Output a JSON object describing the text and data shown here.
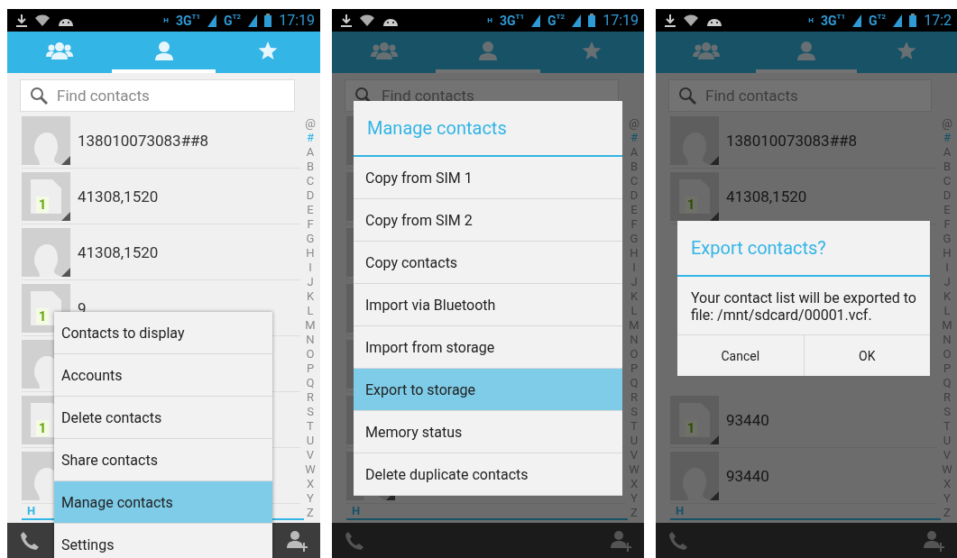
{
  "phones": [
    {
      "status_bar": {
        "data_type": "H",
        "networks": [
          {
            "label": "3G",
            "sim": "T1"
          },
          {
            "label": "G",
            "sim": "T2"
          }
        ],
        "time": "17:19"
      },
      "tabs": [
        {
          "selected": false
        },
        {
          "selected": true
        },
        {
          "selected": false
        }
      ],
      "search": {
        "placeholder": "Find contacts"
      },
      "contacts": [
        {
          "kind": "person",
          "name": "138010073083##8"
        },
        {
          "kind": "sim",
          "badge": "1",
          "name": "41308,1520"
        },
        {
          "kind": "person",
          "name": "41308,1520"
        },
        {
          "kind": "sim",
          "badge": "1",
          "name": "9"
        },
        {
          "kind": "person"
        },
        {
          "kind": "sim",
          "badge": "1"
        },
        {
          "kind": "person"
        }
      ],
      "section_header": "H",
      "index_letters": [
        {
          "label": "@",
          "selected": false
        },
        {
          "label": "#",
          "selected": true
        },
        {
          "label": "A",
          "selected": false
        },
        {
          "label": "B",
          "selected": false
        },
        {
          "label": "C",
          "selected": false
        },
        {
          "label": "D",
          "selected": false
        },
        {
          "label": "E",
          "selected": false
        },
        {
          "label": "F",
          "selected": false
        },
        {
          "label": "G",
          "selected": false
        },
        {
          "label": "H",
          "selected": false
        },
        {
          "label": "I",
          "selected": false
        },
        {
          "label": "J",
          "selected": false
        },
        {
          "label": "K",
          "selected": false
        },
        {
          "label": "L",
          "selected": false
        },
        {
          "label": "M",
          "selected": false
        },
        {
          "label": "N",
          "selected": false
        },
        {
          "label": "O",
          "selected": false
        },
        {
          "label": "P",
          "selected": false
        },
        {
          "label": "Q",
          "selected": false
        },
        {
          "label": "R",
          "selected": false
        },
        {
          "label": "S",
          "selected": false
        },
        {
          "label": "T",
          "selected": false
        },
        {
          "label": "U",
          "selected": false
        },
        {
          "label": "V",
          "selected": false
        },
        {
          "label": "W",
          "selected": false
        },
        {
          "label": "X",
          "selected": false
        },
        {
          "label": "Y",
          "selected": false
        },
        {
          "label": "Z",
          "selected": false
        }
      ],
      "dimmed": false,
      "overlay": {
        "kind": "menu",
        "items": [
          {
            "label": "Contacts to display",
            "selected": false
          },
          {
            "label": "Accounts",
            "selected": false
          },
          {
            "label": "Delete contacts",
            "selected": false
          },
          {
            "label": "Share contacts",
            "selected": false
          },
          {
            "label": "Manage contacts",
            "selected": true
          },
          {
            "label": "Settings",
            "selected": false
          }
        ]
      }
    },
    {
      "status_bar": {
        "data_type": "H",
        "networks": [
          {
            "label": "3G",
            "sim": "T1"
          },
          {
            "label": "G",
            "sim": "T2"
          }
        ],
        "time": "17:19"
      },
      "tabs": [
        {
          "selected": false
        },
        {
          "selected": true
        },
        {
          "selected": false
        }
      ],
      "search": {
        "placeholder": "Find contacts"
      },
      "contacts": [
        {
          "kind": "person"
        },
        {
          "kind": "sim"
        },
        {
          "kind": "person"
        },
        {
          "kind": "sim"
        },
        {
          "kind": "person"
        },
        {
          "kind": "sim"
        },
        {
          "kind": "person"
        }
      ],
      "section_header": "H",
      "index_letters": [
        {
          "label": "@",
          "selected": false
        },
        {
          "label": "#",
          "selected": true
        },
        {
          "label": "A",
          "selected": false
        },
        {
          "label": "B",
          "selected": false
        },
        {
          "label": "C",
          "selected": false
        },
        {
          "label": "D",
          "selected": false
        },
        {
          "label": "E",
          "selected": false
        },
        {
          "label": "F",
          "selected": false
        },
        {
          "label": "G",
          "selected": false
        },
        {
          "label": "H",
          "selected": false
        },
        {
          "label": "I",
          "selected": false
        },
        {
          "label": "J",
          "selected": false
        },
        {
          "label": "K",
          "selected": false
        },
        {
          "label": "L",
          "selected": false
        },
        {
          "label": "M",
          "selected": false
        },
        {
          "label": "N",
          "selected": false
        },
        {
          "label": "O",
          "selected": false
        },
        {
          "label": "P",
          "selected": false
        },
        {
          "label": "Q",
          "selected": false
        },
        {
          "label": "R",
          "selected": false
        },
        {
          "label": "S",
          "selected": false
        },
        {
          "label": "T",
          "selected": false
        },
        {
          "label": "U",
          "selected": false
        },
        {
          "label": "V",
          "selected": false
        },
        {
          "label": "W",
          "selected": false
        },
        {
          "label": "X",
          "selected": false
        },
        {
          "label": "Y",
          "selected": false
        },
        {
          "label": "Z",
          "selected": false
        }
      ],
      "dimmed": true,
      "overlay": {
        "kind": "list_dialog",
        "title": "Manage contacts",
        "items": [
          {
            "label": "Copy from SIM 1",
            "selected": false
          },
          {
            "label": "Copy from SIM 2",
            "selected": false
          },
          {
            "label": "Copy contacts",
            "selected": false
          },
          {
            "label": "Import via Bluetooth",
            "selected": false
          },
          {
            "label": "Import from storage",
            "selected": false
          },
          {
            "label": "Export to storage",
            "selected": true
          },
          {
            "label": "Memory status",
            "selected": false
          },
          {
            "label": "Delete duplicate contacts",
            "selected": false
          }
        ]
      }
    },
    {
      "status_bar": {
        "data_type": "H",
        "networks": [
          {
            "label": "3G",
            "sim": "T1"
          },
          {
            "label": "G",
            "sim": "T2"
          }
        ],
        "time": "17:2"
      },
      "tabs": [
        {
          "selected": false
        },
        {
          "selected": true
        },
        {
          "selected": false
        }
      ],
      "search": {
        "placeholder": "Find contacts"
      },
      "contacts": [
        {
          "kind": "person",
          "name": "138010073083##8"
        },
        {
          "kind": "sim",
          "badge": "1",
          "name": "41308,1520"
        }
      ],
      "contacts_below_dialog": [
        {
          "kind": "sim",
          "badge": "1",
          "name": "93440"
        },
        {
          "kind": "person",
          "name": "93440"
        }
      ],
      "section_header": "H",
      "index_letters": [
        {
          "label": "@",
          "selected": false
        },
        {
          "label": "#",
          "selected": true
        },
        {
          "label": "A",
          "selected": false
        },
        {
          "label": "B",
          "selected": false
        },
        {
          "label": "C",
          "selected": false
        },
        {
          "label": "D",
          "selected": false
        },
        {
          "label": "E",
          "selected": false
        },
        {
          "label": "F",
          "selected": false
        },
        {
          "label": "G",
          "selected": false
        },
        {
          "label": "H",
          "selected": false
        },
        {
          "label": "I",
          "selected": false
        },
        {
          "label": "J",
          "selected": false
        },
        {
          "label": "K",
          "selected": false
        },
        {
          "label": "L",
          "selected": false
        },
        {
          "label": "M",
          "selected": false
        },
        {
          "label": "N",
          "selected": false
        },
        {
          "label": "O",
          "selected": false
        },
        {
          "label": "P",
          "selected": false
        },
        {
          "label": "Q",
          "selected": false
        },
        {
          "label": "R",
          "selected": false
        },
        {
          "label": "S",
          "selected": false
        },
        {
          "label": "T",
          "selected": false
        },
        {
          "label": "U",
          "selected": false
        },
        {
          "label": "V",
          "selected": false
        },
        {
          "label": "W",
          "selected": false
        },
        {
          "label": "X",
          "selected": false
        },
        {
          "label": "Y",
          "selected": false
        },
        {
          "label": "Z",
          "selected": false
        }
      ],
      "dimmed": true,
      "overlay": {
        "kind": "confirm_dialog",
        "title": "Export contacts?",
        "message": "Your contact list will be exported to file: /mnt/sdcard/00001.vcf.",
        "buttons": [
          "Cancel",
          "OK"
        ]
      }
    }
  ]
}
